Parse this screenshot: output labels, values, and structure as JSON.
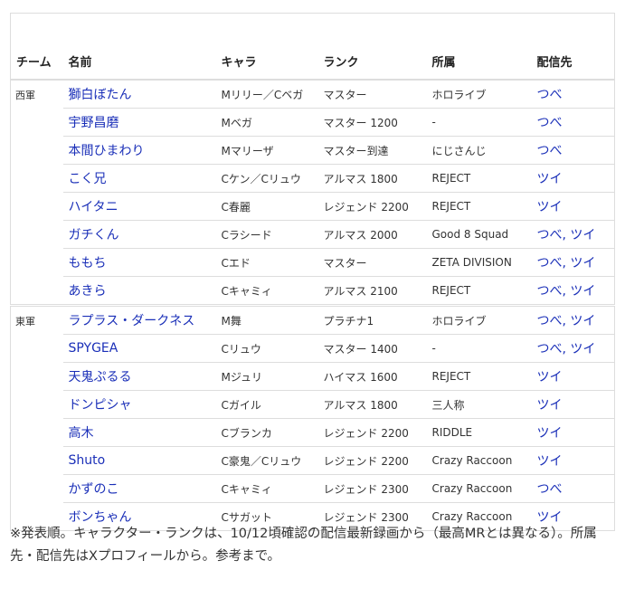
{
  "table": {
    "headers": [
      "チーム",
      "名前",
      "キャラ",
      "ランク",
      "所属",
      "配信先"
    ],
    "groups": [
      {
        "team": "西軍",
        "rows": [
          {
            "name": "獅白ぼたん",
            "chara": "Mリリー／Cベガ",
            "rank": "マスター",
            "aff": "ホロライブ",
            "stream": "つべ"
          },
          {
            "name": "宇野昌磨",
            "chara": "Mベガ",
            "rank": "マスター 1200",
            "aff": "-",
            "stream": "つべ"
          },
          {
            "name": "本間ひまわり",
            "chara": "Mマリーザ",
            "rank": "マスター到達",
            "aff": "にじさんじ",
            "stream": "つべ"
          },
          {
            "name": "こく兄",
            "chara": "Cケン／Cリュウ",
            "rank": "アルマス 1800",
            "aff": "REJECT",
            "stream": "ツイ"
          },
          {
            "name": "ハイタニ",
            "chara": "C春麗",
            "rank": "レジェンド 2200",
            "aff": "REJECT",
            "stream": "ツイ"
          },
          {
            "name": "ガチくん",
            "chara": "Cラシード",
            "rank": "アルマス 2000",
            "aff": "Good 8 Squad",
            "stream": "つべ, ツイ"
          },
          {
            "name": "ももち",
            "chara": "Cエド",
            "rank": "マスター",
            "aff": "ZETA DIVISION",
            "stream": "つべ, ツイ"
          },
          {
            "name": "あきら",
            "chara": "Cキャミィ",
            "rank": "アルマス 2100",
            "aff": "REJECT",
            "stream": "つべ, ツイ"
          }
        ]
      },
      {
        "team": "東軍",
        "rows": [
          {
            "name": "ラプラス・ダークネス",
            "chara": "M舞",
            "rank": "プラチナ1",
            "aff": "ホロライブ",
            "stream": "つべ, ツイ"
          },
          {
            "name": "SPYGEA",
            "chara": "Cリュウ",
            "rank": "マスター 1400",
            "aff": "-",
            "stream": "つべ, ツイ"
          },
          {
            "name": "天鬼ぷるる",
            "chara": "Mジュリ",
            "rank": "ハイマス 1600",
            "aff": "REJECT",
            "stream": "ツイ"
          },
          {
            "name": "ドンピシャ",
            "chara": "Cガイル",
            "rank": "アルマス 1800",
            "aff": "三人称",
            "stream": "ツイ"
          },
          {
            "name": "高木",
            "chara": "Cブランカ",
            "rank": "レジェンド 2200",
            "aff": "RIDDLE",
            "stream": "ツイ"
          },
          {
            "name": "Shuto",
            "chara": "C豪鬼／Cリュウ",
            "rank": "レジェンド 2200",
            "aff": "Crazy Raccoon",
            "stream": "ツイ"
          },
          {
            "name": "かずのこ",
            "chara": "Cキャミィ",
            "rank": "レジェンド 2300",
            "aff": "Crazy Raccoon",
            "stream": "つべ"
          },
          {
            "name": "ボンちゃん",
            "chara": "Cサガット",
            "rank": "レジェンド 2300",
            "aff": "Crazy Raccoon",
            "stream": "ツイ"
          }
        ]
      }
    ]
  },
  "note": "※発表順。キャラクター・ランクは、10/12頃確認の配信最新録画から（最高MRとは異なる）。所属先・配信先はXプロフィールから。参考まで。",
  "colors": {
    "link": "#1a2fb8",
    "border": "#dddddd",
    "text": "#333333"
  }
}
